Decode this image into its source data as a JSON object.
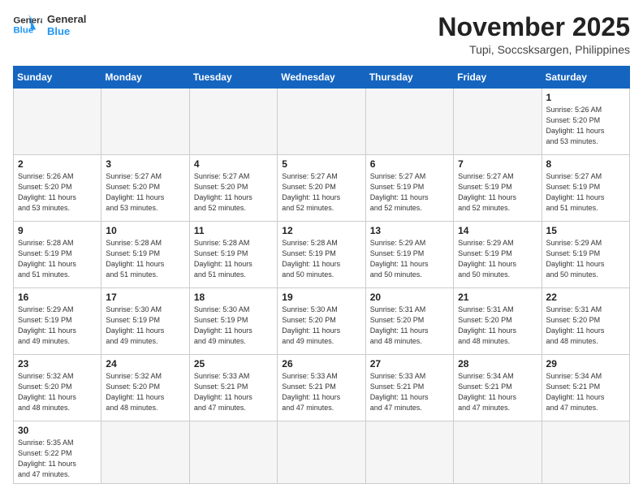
{
  "logo": {
    "text_general": "General",
    "text_blue": "Blue"
  },
  "title": "November 2025",
  "location": "Tupi, Soccsksargen, Philippines",
  "weekdays": [
    "Sunday",
    "Monday",
    "Tuesday",
    "Wednesday",
    "Thursday",
    "Friday",
    "Saturday"
  ],
  "weeks": [
    [
      {
        "day": "",
        "info": ""
      },
      {
        "day": "",
        "info": ""
      },
      {
        "day": "",
        "info": ""
      },
      {
        "day": "",
        "info": ""
      },
      {
        "day": "",
        "info": ""
      },
      {
        "day": "",
        "info": ""
      },
      {
        "day": "1",
        "info": "Sunrise: 5:26 AM\nSunset: 5:20 PM\nDaylight: 11 hours\nand 53 minutes."
      }
    ],
    [
      {
        "day": "2",
        "info": "Sunrise: 5:26 AM\nSunset: 5:20 PM\nDaylight: 11 hours\nand 53 minutes."
      },
      {
        "day": "3",
        "info": "Sunrise: 5:27 AM\nSunset: 5:20 PM\nDaylight: 11 hours\nand 53 minutes."
      },
      {
        "day": "4",
        "info": "Sunrise: 5:27 AM\nSunset: 5:20 PM\nDaylight: 11 hours\nand 52 minutes."
      },
      {
        "day": "5",
        "info": "Sunrise: 5:27 AM\nSunset: 5:20 PM\nDaylight: 11 hours\nand 52 minutes."
      },
      {
        "day": "6",
        "info": "Sunrise: 5:27 AM\nSunset: 5:19 PM\nDaylight: 11 hours\nand 52 minutes."
      },
      {
        "day": "7",
        "info": "Sunrise: 5:27 AM\nSunset: 5:19 PM\nDaylight: 11 hours\nand 52 minutes."
      },
      {
        "day": "8",
        "info": "Sunrise: 5:27 AM\nSunset: 5:19 PM\nDaylight: 11 hours\nand 51 minutes."
      }
    ],
    [
      {
        "day": "9",
        "info": "Sunrise: 5:28 AM\nSunset: 5:19 PM\nDaylight: 11 hours\nand 51 minutes."
      },
      {
        "day": "10",
        "info": "Sunrise: 5:28 AM\nSunset: 5:19 PM\nDaylight: 11 hours\nand 51 minutes."
      },
      {
        "day": "11",
        "info": "Sunrise: 5:28 AM\nSunset: 5:19 PM\nDaylight: 11 hours\nand 51 minutes."
      },
      {
        "day": "12",
        "info": "Sunrise: 5:28 AM\nSunset: 5:19 PM\nDaylight: 11 hours\nand 50 minutes."
      },
      {
        "day": "13",
        "info": "Sunrise: 5:29 AM\nSunset: 5:19 PM\nDaylight: 11 hours\nand 50 minutes."
      },
      {
        "day": "14",
        "info": "Sunrise: 5:29 AM\nSunset: 5:19 PM\nDaylight: 11 hours\nand 50 minutes."
      },
      {
        "day": "15",
        "info": "Sunrise: 5:29 AM\nSunset: 5:19 PM\nDaylight: 11 hours\nand 50 minutes."
      }
    ],
    [
      {
        "day": "16",
        "info": "Sunrise: 5:29 AM\nSunset: 5:19 PM\nDaylight: 11 hours\nand 49 minutes."
      },
      {
        "day": "17",
        "info": "Sunrise: 5:30 AM\nSunset: 5:19 PM\nDaylight: 11 hours\nand 49 minutes."
      },
      {
        "day": "18",
        "info": "Sunrise: 5:30 AM\nSunset: 5:19 PM\nDaylight: 11 hours\nand 49 minutes."
      },
      {
        "day": "19",
        "info": "Sunrise: 5:30 AM\nSunset: 5:20 PM\nDaylight: 11 hours\nand 49 minutes."
      },
      {
        "day": "20",
        "info": "Sunrise: 5:31 AM\nSunset: 5:20 PM\nDaylight: 11 hours\nand 48 minutes."
      },
      {
        "day": "21",
        "info": "Sunrise: 5:31 AM\nSunset: 5:20 PM\nDaylight: 11 hours\nand 48 minutes."
      },
      {
        "day": "22",
        "info": "Sunrise: 5:31 AM\nSunset: 5:20 PM\nDaylight: 11 hours\nand 48 minutes."
      }
    ],
    [
      {
        "day": "23",
        "info": "Sunrise: 5:32 AM\nSunset: 5:20 PM\nDaylight: 11 hours\nand 48 minutes."
      },
      {
        "day": "24",
        "info": "Sunrise: 5:32 AM\nSunset: 5:20 PM\nDaylight: 11 hours\nand 48 minutes."
      },
      {
        "day": "25",
        "info": "Sunrise: 5:33 AM\nSunset: 5:21 PM\nDaylight: 11 hours\nand 47 minutes."
      },
      {
        "day": "26",
        "info": "Sunrise: 5:33 AM\nSunset: 5:21 PM\nDaylight: 11 hours\nand 47 minutes."
      },
      {
        "day": "27",
        "info": "Sunrise: 5:33 AM\nSunset: 5:21 PM\nDaylight: 11 hours\nand 47 minutes."
      },
      {
        "day": "28",
        "info": "Sunrise: 5:34 AM\nSunset: 5:21 PM\nDaylight: 11 hours\nand 47 minutes."
      },
      {
        "day": "29",
        "info": "Sunrise: 5:34 AM\nSunset: 5:21 PM\nDaylight: 11 hours\nand 47 minutes."
      }
    ],
    [
      {
        "day": "30",
        "info": "Sunrise: 5:35 AM\nSunset: 5:22 PM\nDaylight: 11 hours\nand 47 minutes."
      },
      {
        "day": "",
        "info": ""
      },
      {
        "day": "",
        "info": ""
      },
      {
        "day": "",
        "info": ""
      },
      {
        "day": "",
        "info": ""
      },
      {
        "day": "",
        "info": ""
      },
      {
        "day": "",
        "info": ""
      }
    ]
  ]
}
